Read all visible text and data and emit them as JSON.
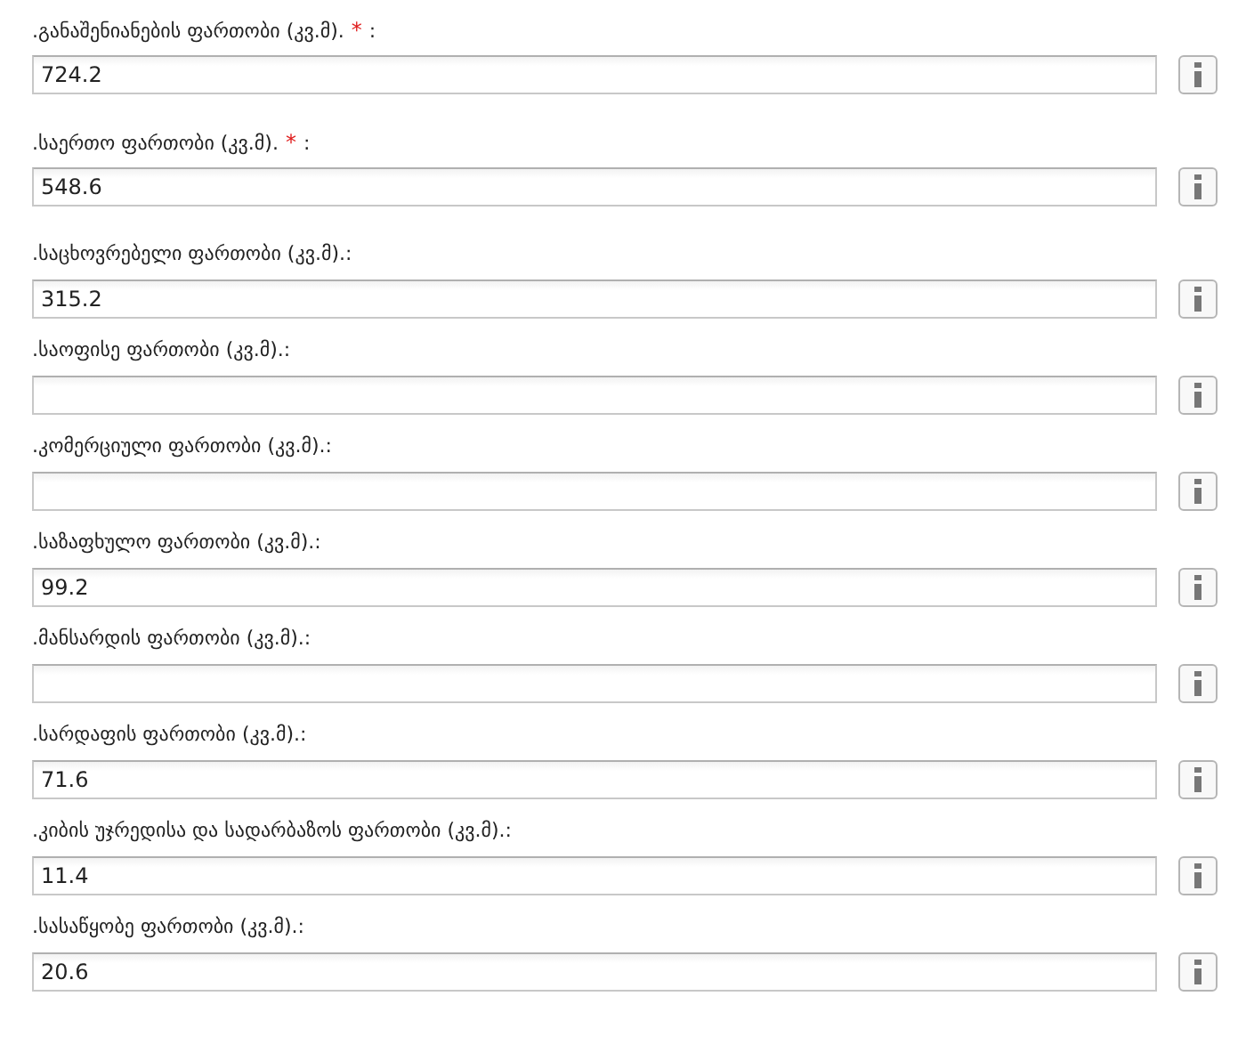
{
  "fields": [
    {
      "label": ".განაშენიანების ფართობი (კვ.მ).",
      "required_mark": "*",
      "suffix": ":",
      "value": "724.2"
    },
    {
      "label": ".საერთო ფართობი (კვ.მ).",
      "required_mark": "*",
      "suffix": ":",
      "value": "548.6"
    },
    {
      "label": ".საცხოვრებელი ფართობი (კვ.მ).:",
      "value": "315.2"
    },
    {
      "label": ".საოფისე ფართობი (კვ.მ).:"
    },
    {
      "label": ".კომერციული ფართობი (კვ.მ).:"
    },
    {
      "label": ".საზაფხულო ფართობი (კვ.მ).:",
      "value": "99.2"
    },
    {
      "label": ".მანსარდის ფართობი (კვ.მ).:"
    },
    {
      "label": ".სარდაფის ფართობი (კვ.მ).:",
      "value": "71.6"
    },
    {
      "label": ".კიბის უჯრედისა და სადარბაზოს ფართობი (კვ.მ).:",
      "value": "11.4"
    },
    {
      "label": ".სასაწყობე ფართობი (კვ.მ).:",
      "value": "20.6"
    }
  ]
}
